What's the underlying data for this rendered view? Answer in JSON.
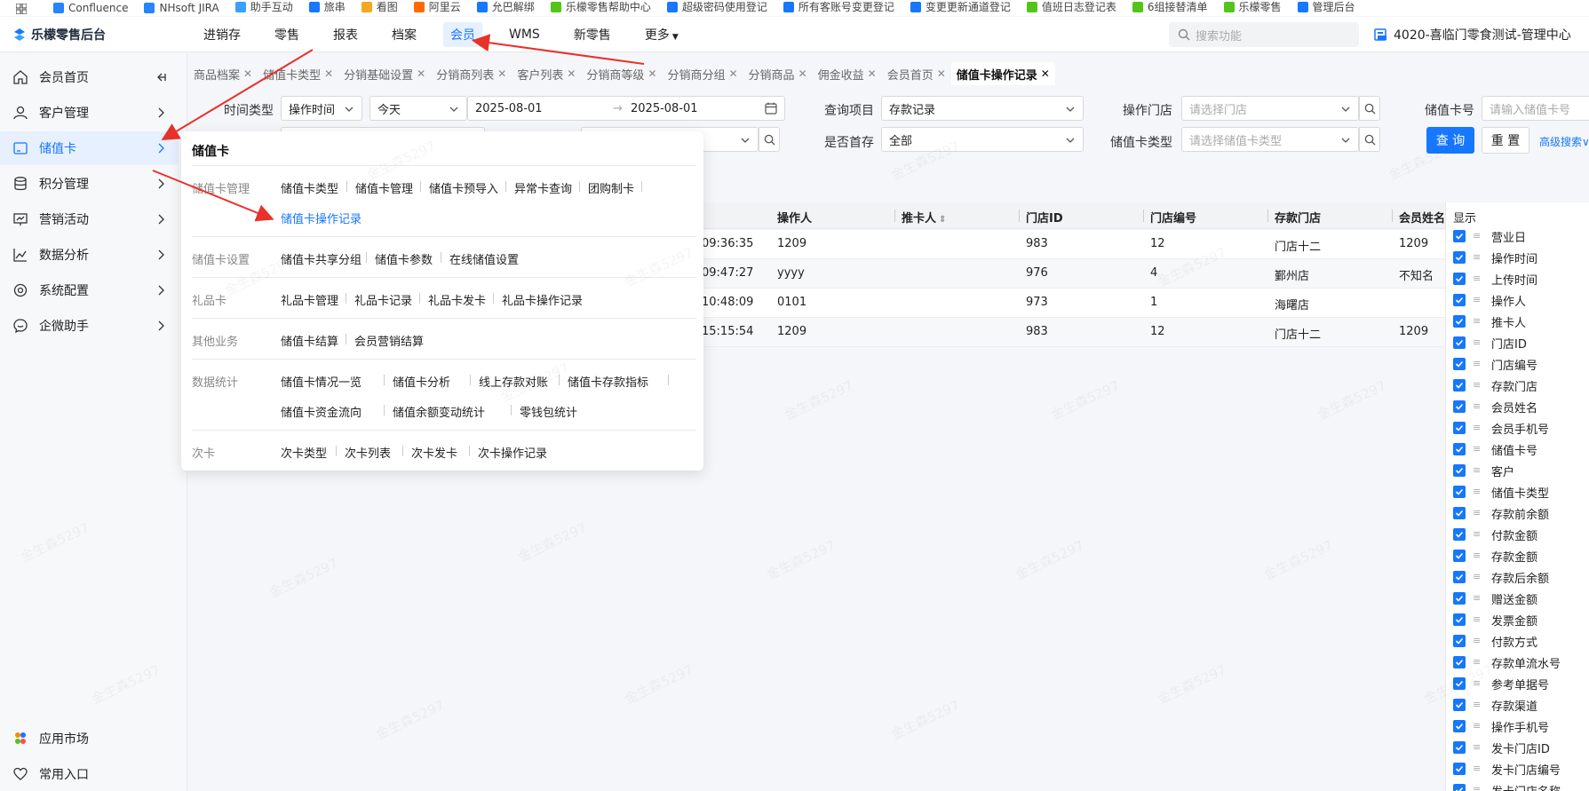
{
  "bookmarks": [
    "Confluence",
    "NHsoft JIRA",
    "助手互动",
    "旅串",
    "看图",
    "阿里云",
    "允巴解绑",
    "乐檬零售帮助中心",
    "超级密码使用登记",
    "所有客账号变更登记",
    "变更更新通道登记",
    "值班日志登记表",
    "6组接替清单",
    "乐檬零售",
    "管理后台"
  ],
  "brand": "乐檬零售后台",
  "nav": [
    "进销存",
    "零售",
    "报表",
    "档案",
    "会员",
    "WMS",
    "新零售",
    "更多"
  ],
  "nav_active_index": 4,
  "search_placeholder": "搜索功能",
  "store_name": "4020-喜临门零食测试-管理中心",
  "sidebar": [
    "会员首页",
    "客户管理",
    "储值卡",
    "积分管理",
    "营销活动",
    "数据分析",
    "系统配置",
    "企微助手"
  ],
  "sidebar_active_index": 2,
  "sidebar_bottom": [
    "应用市场",
    "常用入口"
  ],
  "tabs": [
    "商品档案",
    "储值卡类型",
    "分销基础设置",
    "分销商列表",
    "客户列表",
    "分销商等级",
    "分销商分组",
    "分销商品",
    "佣金收益",
    "会员首页",
    "储值卡操作记录"
  ],
  "filters": {
    "time_type_label": "时间类型",
    "time_type_value": "操作时间",
    "date_range_preset": "今天",
    "start_date": "2025-08-01",
    "end_date": "2025-08-01",
    "query_item_label": "查询项目",
    "query_item_value": "存款记录",
    "op_store_label": "操作门店",
    "op_store_placeholder": "请选择门店",
    "card_no_label": "储值卡号",
    "card_no_placeholder": "请输入储值卡号",
    "first_deposit_label": "是否首存",
    "first_deposit_value": "全部",
    "card_type_label": "储值卡类型",
    "card_type_placeholder": "请选择储值卡类型",
    "query_button": "查 询",
    "reset_button": "重 置",
    "advanced_search": "高级搜索"
  },
  "table": {
    "headers": [
      "操作人",
      "推卡人",
      "门店ID",
      "门店编号",
      "存款门店",
      "会员姓名"
    ],
    "rows": [
      {
        "time": "09:36:35",
        "operator": "1209",
        "store_id": "983",
        "store_no": "12",
        "store": "门店十二",
        "member": "1209"
      },
      {
        "time": "09:47:27",
        "operator": "yyyy",
        "store_id": "976",
        "store_no": "4",
        "store": "鄞州店",
        "member": "不知名"
      },
      {
        "time": "10:48:09",
        "operator": "0101",
        "store_id": "973",
        "store_no": "1",
        "store": "海曙店",
        "member": ""
      },
      {
        "time": "15:15:54",
        "operator": "1209",
        "store_id": "983",
        "store_no": "12",
        "store": "门店十二",
        "member": "1209"
      }
    ]
  },
  "mega_menu": {
    "title": "储值卡",
    "groups": [
      {
        "name": "储值卡管理",
        "links": [
          "储值卡类型",
          "储值卡管理",
          "储值卡预导入",
          "异常卡查询",
          "团购制卡",
          "储值卡操作记录"
        ]
      },
      {
        "name": "储值卡设置",
        "links": [
          "储值卡共享分组",
          "储值卡参数",
          "在线储值设置"
        ]
      },
      {
        "name": "礼品卡",
        "links": [
          "礼品卡管理",
          "礼品卡记录",
          "礼品卡发卡",
          "礼品卡操作记录"
        ]
      },
      {
        "name": "其他业务",
        "links": [
          "储值卡结算",
          "会员营销结算"
        ]
      },
      {
        "name": "数据统计",
        "links": [
          "储值卡情况一览",
          "储值卡分析",
          "线上存款对账",
          "储值卡存款指标",
          "储值卡资金流向",
          "储值余额变动统计",
          "零钱包统计"
        ]
      },
      {
        "name": "次卡",
        "links": [
          "次卡类型",
          "次卡列表",
          "次卡发卡",
          "次卡操作记录"
        ]
      }
    ],
    "current_link": "储值卡操作记录"
  },
  "column_picker": {
    "title": "显示",
    "columns": [
      "营业日",
      "操作时间",
      "上传时间",
      "操作人",
      "推卡人",
      "门店ID",
      "门店编号",
      "存款门店",
      "会员姓名",
      "会员手机号",
      "储值卡号",
      "客户",
      "储值卡类型",
      "存款前余额",
      "付款金额",
      "存款金额",
      "存款后余额",
      "赠送金额",
      "发票金额",
      "付款方式",
      "存款单流水号",
      "参考单据号",
      "存款渠道",
      "操作手机号",
      "发卡门店ID",
      "发卡门店编号",
      "发卡门店名称"
    ]
  },
  "watermark": "金生森5297",
  "colors": {
    "primary": "#1677ff",
    "annotation_arrow": "#e8312a"
  }
}
